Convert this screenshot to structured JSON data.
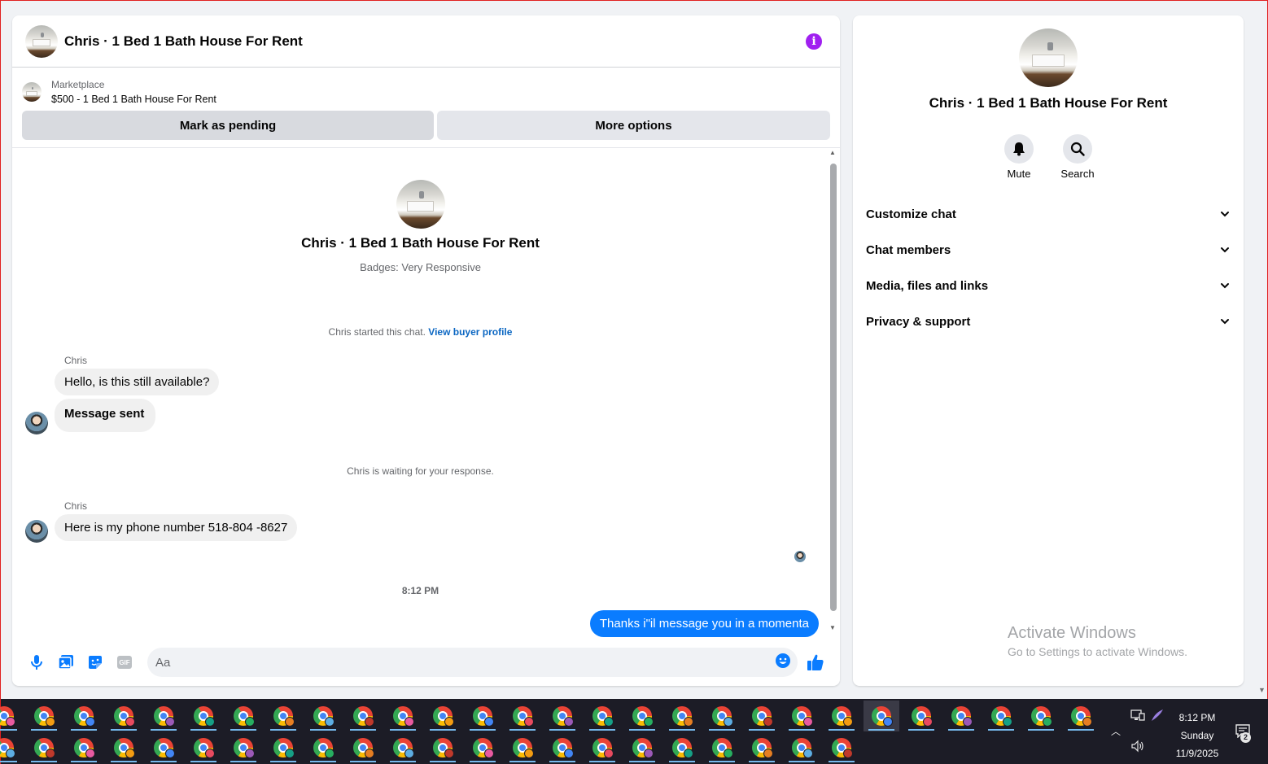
{
  "chat": {
    "title": "Chris · 1 Bed 1 Bath House For Rent",
    "listing": {
      "source": "Marketplace",
      "name": "$500 - 1 Bed 1 Bath House For Rent",
      "mark_pending_label": "Mark as pending",
      "more_options_label": "More options"
    },
    "intro": {
      "title": "Chris · 1 Bed 1 Bath House For Rent",
      "badges": "Badges: Very Responsive"
    },
    "started_note": "Chris started this chat.",
    "buyer_profile_link": "View buyer profile",
    "waiting_note": "Chris is waiting for your response.",
    "messages": [
      {
        "sender": "Chris",
        "text": "Hello, is this still available?"
      },
      {
        "text": "Message sent"
      },
      {
        "sender": "Chris",
        "text": "Here is my phone number 518-804 -8627"
      },
      {
        "text": "Thanks i\"il message you in a momenta"
      }
    ],
    "timestamp": "8:12 PM",
    "composer_placeholder": "Aa"
  },
  "info_panel": {
    "title": "Chris · 1 Bed 1 Bath House For Rent",
    "actions": [
      {
        "label": "Mute",
        "icon": "bell-icon"
      },
      {
        "label": "Search",
        "icon": "search-icon"
      }
    ],
    "sections": [
      "Customize chat",
      "Chat members",
      "Media, files and links",
      "Privacy & support"
    ]
  },
  "watermark": {
    "title": "Activate Windows",
    "subtitle": "Go to Settings to activate Windows."
  },
  "taskbar": {
    "time": "8:12 PM",
    "day": "Sunday",
    "date": "11/9/2025",
    "notification_count": "2"
  },
  "colors": {
    "accent": "#0a7cff",
    "info": "#a020f0",
    "link": "#0a66c2"
  }
}
